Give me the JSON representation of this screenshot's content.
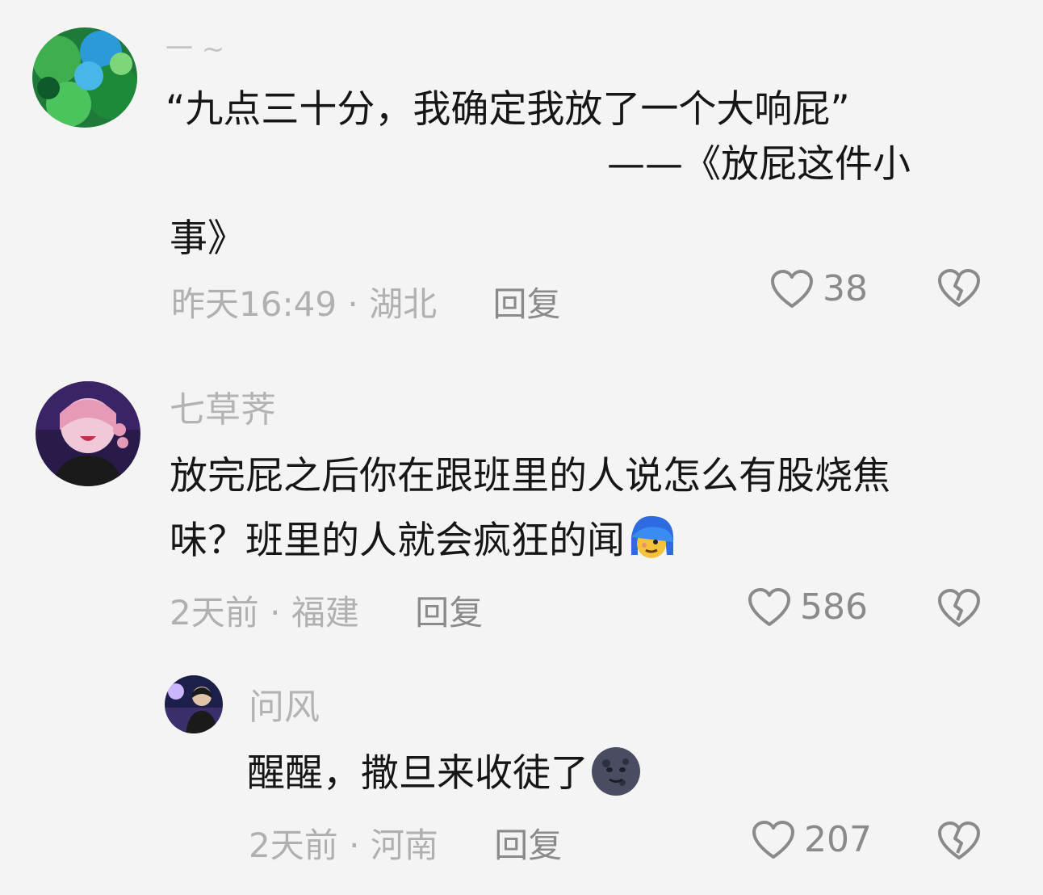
{
  "comments": [
    {
      "username": "一 ~",
      "lines": [
        "“九点三十分，我确定我放了一个大响屁”",
        "——《放屁这件小",
        "事》"
      ],
      "time": "昨天16:49",
      "location": "湖北",
      "reply_label": "回复",
      "likes": "38"
    },
    {
      "username": "七草荠",
      "lines": [
        "放完屁之后你在跟班里的人说怎么有股烧焦",
        "味？班里的人就会疯狂的闻"
      ],
      "emoji": "blue-hair-sniffing-emoji",
      "time": "2天前",
      "location": "福建",
      "reply_label": "回复",
      "likes": "586"
    }
  ],
  "reply": {
    "username": "问风",
    "text": "醒醒，撒旦来收徒了",
    "emoji": "dark-moon-face-emoji",
    "time": "2天前",
    "location": "河南",
    "reply_label": "回复",
    "likes": "207"
  },
  "meta_separator": "·",
  "colors": {
    "background": "#f4f4f4",
    "text": "#161616",
    "muted": "#b0b0b0",
    "action": "#8a8a8a"
  }
}
